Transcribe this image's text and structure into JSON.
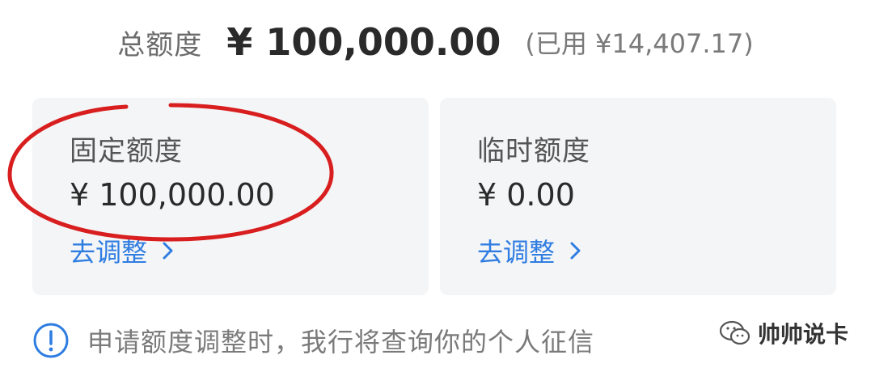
{
  "header": {
    "total_label": "总额度",
    "total_amount": "¥ 100,000.00",
    "used_text": "(已用 ¥14,407.17)"
  },
  "cards": [
    {
      "title": "固定额度",
      "amount": "¥ 100,000.00",
      "link_label": "去调整"
    },
    {
      "title": "临时额度",
      "amount": "¥ 0.00",
      "link_label": "去调整"
    }
  ],
  "notice": {
    "text": "申请额度调整时，我行将查询你的个人征信"
  },
  "watermark": {
    "text": "帅帅说卡"
  },
  "colors": {
    "link": "#2f7de1",
    "annotation": "#d81e1e",
    "card_bg": "#f4f5f7"
  },
  "icons": {
    "info": "info-circle-icon",
    "chevron": "chevron-right-icon",
    "watermark": "wechat-icon"
  }
}
